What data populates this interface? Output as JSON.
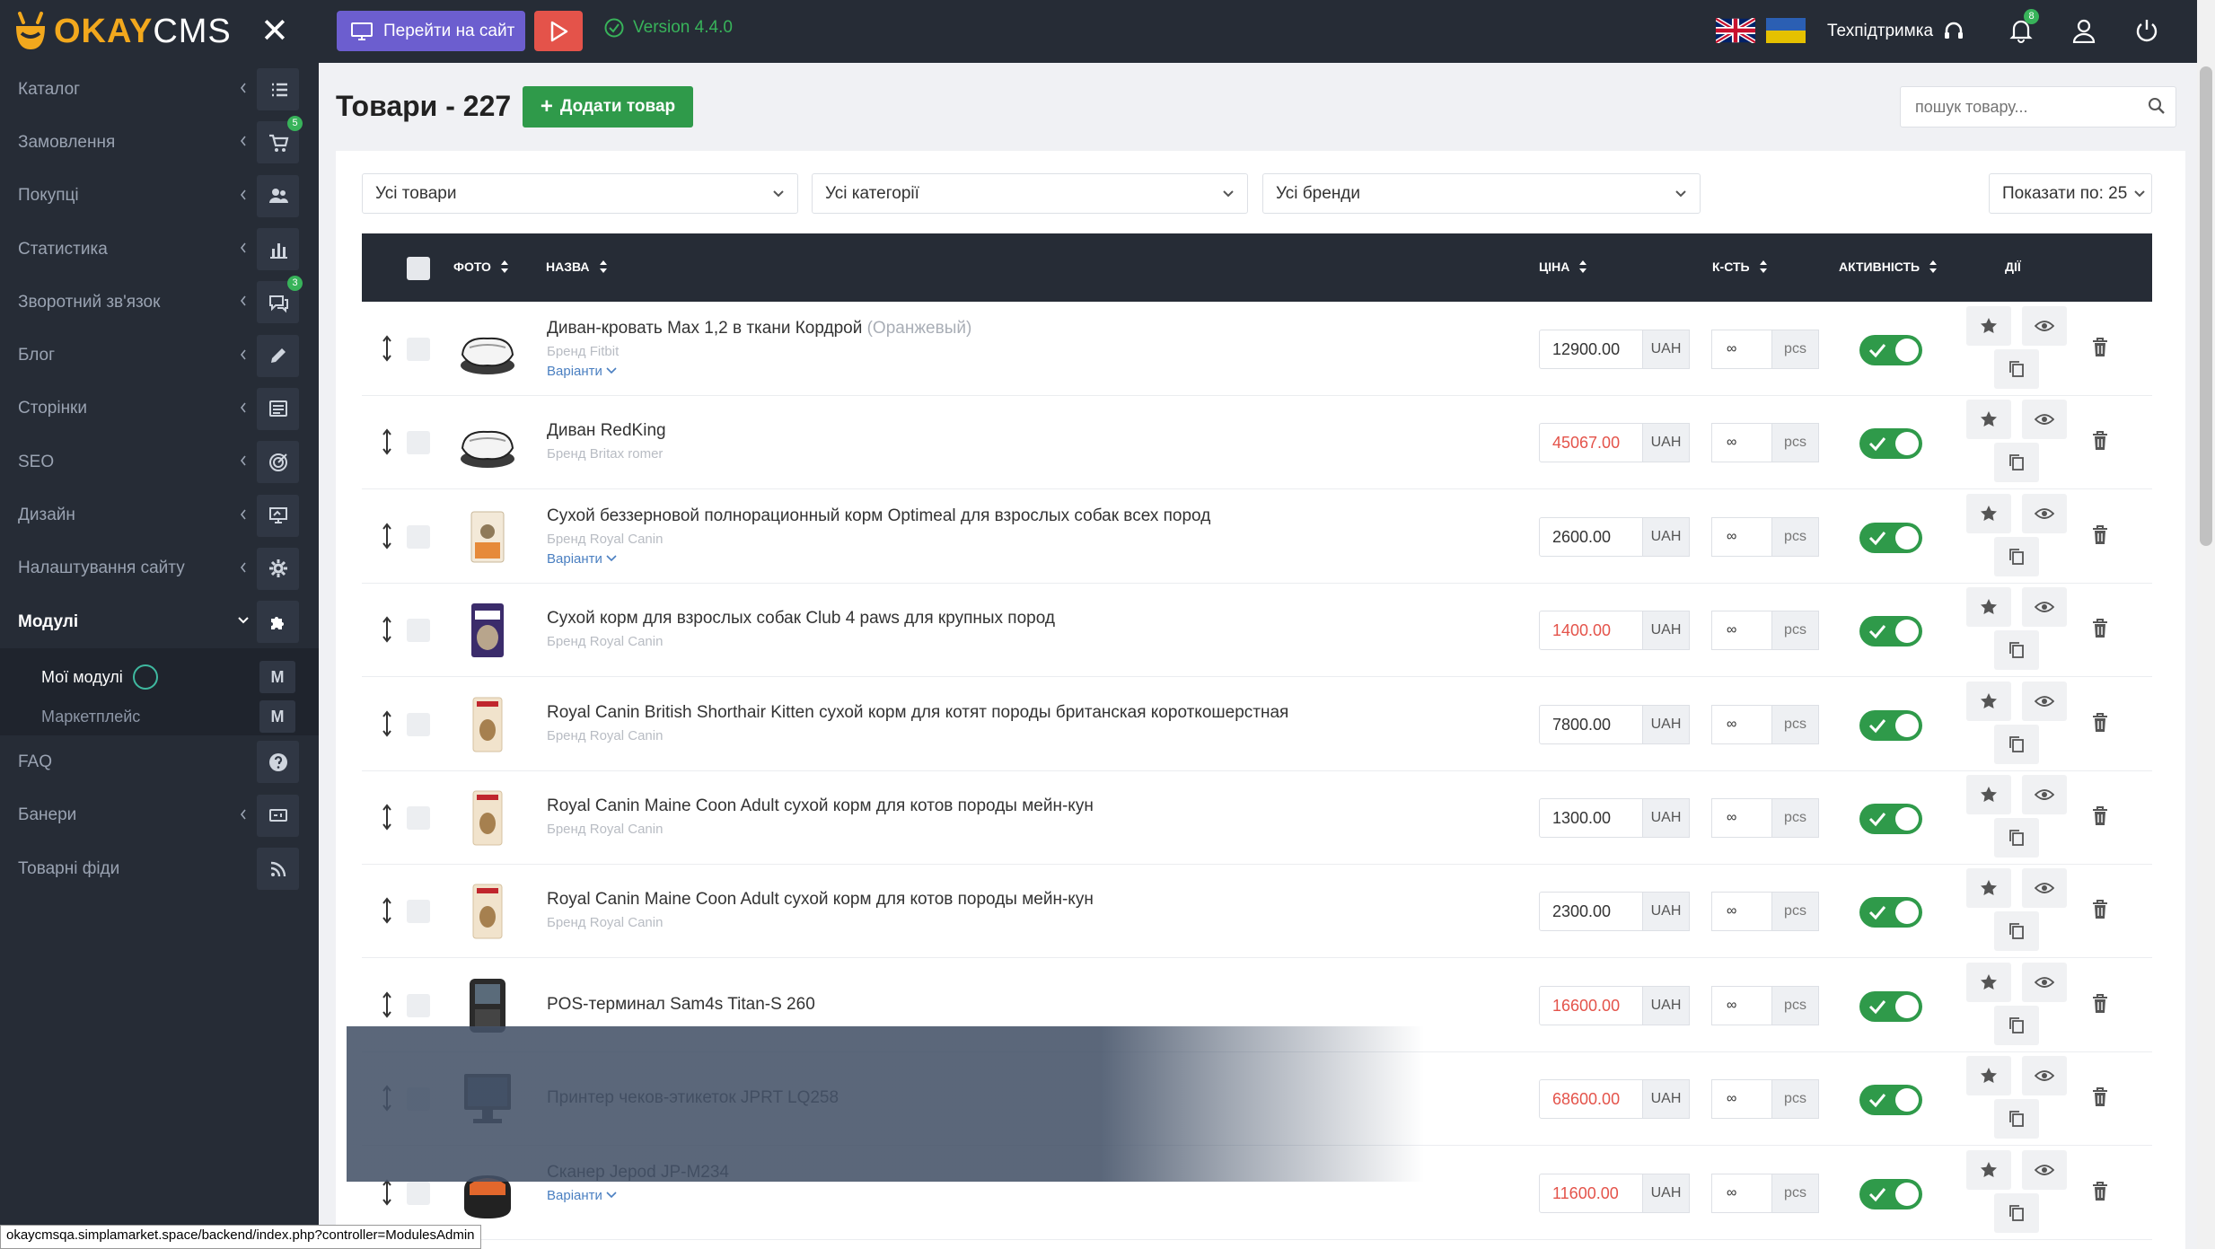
{
  "brand": {
    "okay": "OKAY",
    "cms": "CMS"
  },
  "sidebar": {
    "items": [
      {
        "label": "Каталог",
        "icon": "list-icon"
      },
      {
        "label": "Замовлення",
        "icon": "cart-icon",
        "badge": "5"
      },
      {
        "label": "Покупці",
        "icon": "users-icon"
      },
      {
        "label": "Статистика",
        "icon": "bar-chart-icon"
      },
      {
        "label": "Зворотний зв'язок",
        "icon": "comments-icon",
        "badge": "3"
      },
      {
        "label": "Блог",
        "icon": "pencil-icon"
      },
      {
        "label": "Сторінки",
        "icon": "pages-icon"
      },
      {
        "label": "SEO",
        "icon": "target-icon"
      },
      {
        "label": "Дизайн",
        "icon": "monitor-icon"
      },
      {
        "label": "Налаштування сайту",
        "icon": "gear-icon"
      },
      {
        "label": "Модулі",
        "icon": "puzzle-icon"
      }
    ],
    "submenu": [
      {
        "label": "Мої модулі",
        "badge": "M"
      },
      {
        "label": "Маркетплейс",
        "badge": "M"
      }
    ],
    "items_after": [
      {
        "label": "FAQ",
        "icon": "question-icon"
      },
      {
        "label": "Банери",
        "icon": "banner-icon"
      },
      {
        "label": "Товарні фіди",
        "icon": "rss-icon"
      }
    ]
  },
  "topbar": {
    "site_button": "Перейти на сайт",
    "version": "Version 4.4.0",
    "support": "Техпідтримка",
    "notifications": "8"
  },
  "page": {
    "title": "Товари - 227",
    "add_button": "Додати товар",
    "search_placeholder": "пошук товару..."
  },
  "filters": {
    "products": "Усі товари",
    "categories": "Усі категорії",
    "brands": "Усі бренди",
    "per_page": "Показати по: 25"
  },
  "table": {
    "headers": {
      "photo": "Фото",
      "name": "Назва",
      "price": "Ціна",
      "qty": "К-сть",
      "active": "Активність",
      "actions": "Дії"
    },
    "currency": "UAH",
    "unit": "pcs",
    "qty_symbol": "∞",
    "variants_label": "Варіанти",
    "rows": [
      {
        "name": "Диван-кровать Max 1,2 в ткани Кордрой",
        "variant": "(Оранжевый)",
        "brand": "Бренд Fitbit",
        "has_variants": true,
        "price": "12900.00",
        "price_red": false,
        "thumb": "sofa-white"
      },
      {
        "name": "Диван RedKing",
        "variant": "",
        "brand": "Бренд Britax romer",
        "has_variants": false,
        "price": "45067.00",
        "price_red": true,
        "thumb": "sofa-white"
      },
      {
        "name": "Сухой беззерновой полнорационный корм Optimeal для взрослых собак всех пород",
        "variant": "",
        "brand": "Бренд Royal Canin",
        "has_variants": true,
        "price": "2600.00",
        "price_red": false,
        "thumb": "bag-orange"
      },
      {
        "name": "Сухой корм для взрослых собак Club 4 paws для крупных пород",
        "variant": "",
        "brand": "Бренд Royal Canin",
        "has_variants": false,
        "price": "1400.00",
        "price_red": true,
        "thumb": "bag-purple"
      },
      {
        "name": "Royal Canin British Shorthair Kitten сухой корм для котят породы британская короткошерстная",
        "variant": "",
        "brand": "Бренд Royal Canin",
        "has_variants": false,
        "price": "7800.00",
        "price_red": false,
        "thumb": "bag-beige"
      },
      {
        "name": "Royal Canin Maine Coon Adult сухой корм для котов породы мейн-кун",
        "variant": "",
        "brand": "Бренд Royal Canin",
        "has_variants": false,
        "price": "1300.00",
        "price_red": false,
        "thumb": "bag-beige"
      },
      {
        "name": "Royal Canin Maine Coon Adult сухой корм для котов породы мейн-кун",
        "variant": "",
        "brand": "Бренд Royal Canin",
        "has_variants": false,
        "price": "2300.00",
        "price_red": false,
        "thumb": "bag-beige"
      },
      {
        "name": "POS-терминал Sam4s Titan-S 260",
        "variant": "",
        "brand": "",
        "has_variants": false,
        "price": "16600.00",
        "price_red": true,
        "thumb": "pos-dark"
      },
      {
        "name": "Принтер чеков-этикеток JPRT LQ258",
        "variant": "",
        "brand": "",
        "has_variants": false,
        "price": "68600.00",
        "price_red": true,
        "thumb": "monitor-dark"
      },
      {
        "name": "Сканер Jepod JP-M234",
        "variant": "",
        "brand": "",
        "has_variants": true,
        "price": "11600.00",
        "price_red": true,
        "thumb": "scanner-orange"
      }
    ]
  },
  "statusbar": "okaycmsqa.simplamarket.space/backend/index.php?controller=ModulesAdmin",
  "colors": {
    "sidebar": "#262c36",
    "accent_green": "#2f9a4a",
    "accent_purple": "#6c5ecf",
    "accent_red": "#e4534a",
    "logo_orange": "#f2a81d"
  }
}
